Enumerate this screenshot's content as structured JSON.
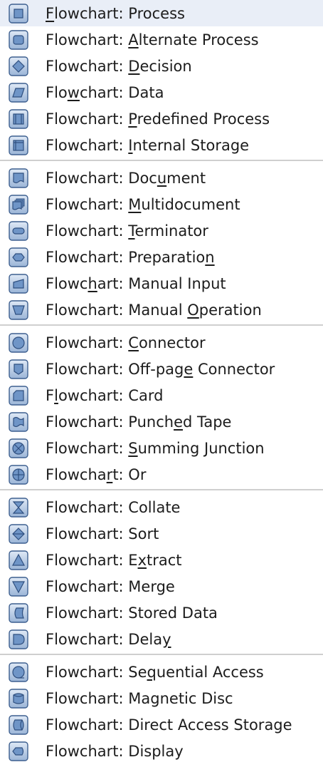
{
  "menu": {
    "groups": [
      {
        "items": [
          {
            "label": "Flowchart: Process",
            "mnemonic_index": 0,
            "icon": "process-icon"
          },
          {
            "label": "Flowchart: Alternate Process",
            "mnemonic_index": 11,
            "icon": "alternate-process-icon"
          },
          {
            "label": "Flowchart: Decision",
            "mnemonic_index": 11,
            "icon": "decision-icon"
          },
          {
            "label": "Flowchart: Data",
            "mnemonic_index": 3,
            "icon": "data-icon"
          },
          {
            "label": "Flowchart: Predefined Process",
            "mnemonic_index": 11,
            "icon": "predefined-process-icon"
          },
          {
            "label": "Flowchart: Internal Storage",
            "mnemonic_index": 11,
            "icon": "internal-storage-icon"
          }
        ]
      },
      {
        "items": [
          {
            "label": "Flowchart: Document",
            "mnemonic_index": 14,
            "icon": "document-icon"
          },
          {
            "label": "Flowchart: Multidocument",
            "mnemonic_index": 11,
            "icon": "multidocument-icon"
          },
          {
            "label": "Flowchart: Terminator",
            "mnemonic_index": 11,
            "icon": "terminator-icon"
          },
          {
            "label": "Flowchart: Preparation",
            "mnemonic_index": 21,
            "icon": "preparation-icon"
          },
          {
            "label": "Flowchart: Manual Input",
            "mnemonic_index": 5,
            "icon": "manual-input-icon"
          },
          {
            "label": "Flowchart: Manual Operation",
            "mnemonic_index": 18,
            "icon": "manual-operation-icon"
          }
        ]
      },
      {
        "items": [
          {
            "label": "Flowchart: Connector",
            "mnemonic_index": 11,
            "icon": "connector-icon"
          },
          {
            "label": "Flowchart: Off-page Connector",
            "mnemonic_index": 18,
            "icon": "off-page-connector-icon"
          },
          {
            "label": "Flowchart: Card",
            "mnemonic_index": 1,
            "icon": "card-icon"
          },
          {
            "label": "Flowchart: Punched Tape",
            "mnemonic_index": 16,
            "icon": "punched-tape-icon"
          },
          {
            "label": "Flowchart: Summing Junction",
            "mnemonic_index": 11,
            "icon": "summing-junction-icon"
          },
          {
            "label": "Flowchart: Or",
            "mnemonic_index": 7,
            "icon": "or-icon"
          }
        ]
      },
      {
        "items": [
          {
            "label": "Flowchart: Collate",
            "mnemonic_index": -1,
            "icon": "collate-icon"
          },
          {
            "label": "Flowchart: Sort",
            "mnemonic_index": -1,
            "icon": "sort-icon"
          },
          {
            "label": "Flowchart: Extract",
            "mnemonic_index": 12,
            "icon": "extract-icon"
          },
          {
            "label": "Flowchart: Merge",
            "mnemonic_index": -1,
            "icon": "merge-icon"
          },
          {
            "label": "Flowchart: Stored Data",
            "mnemonic_index": -1,
            "icon": "stored-data-icon"
          },
          {
            "label": "Flowchart: Delay",
            "mnemonic_index": 15,
            "icon": "delay-icon"
          }
        ]
      },
      {
        "items": [
          {
            "label": "Flowchart: Sequential Access",
            "mnemonic_index": 13,
            "icon": "sequential-access-icon"
          },
          {
            "label": "Flowchart: Magnetic Disc",
            "mnemonic_index": -1,
            "icon": "magnetic-disc-icon"
          },
          {
            "label": "Flowchart: Direct Access Storage",
            "mnemonic_index": -1,
            "icon": "direct-access-storage-icon"
          },
          {
            "label": "Flowchart: Display",
            "mnemonic_index": -1,
            "icon": "display-icon"
          }
        ]
      }
    ],
    "colors": {
      "icon_border": "#3d5f8f",
      "icon_fill_top": "#dfe9f6",
      "icon_fill_bottom": "#9bb5d7",
      "shape_fill": "#6f95c7",
      "shape_stroke": "#2f4f7f",
      "separator": "#cfcfcf",
      "text": "#1c1c1c"
    }
  }
}
